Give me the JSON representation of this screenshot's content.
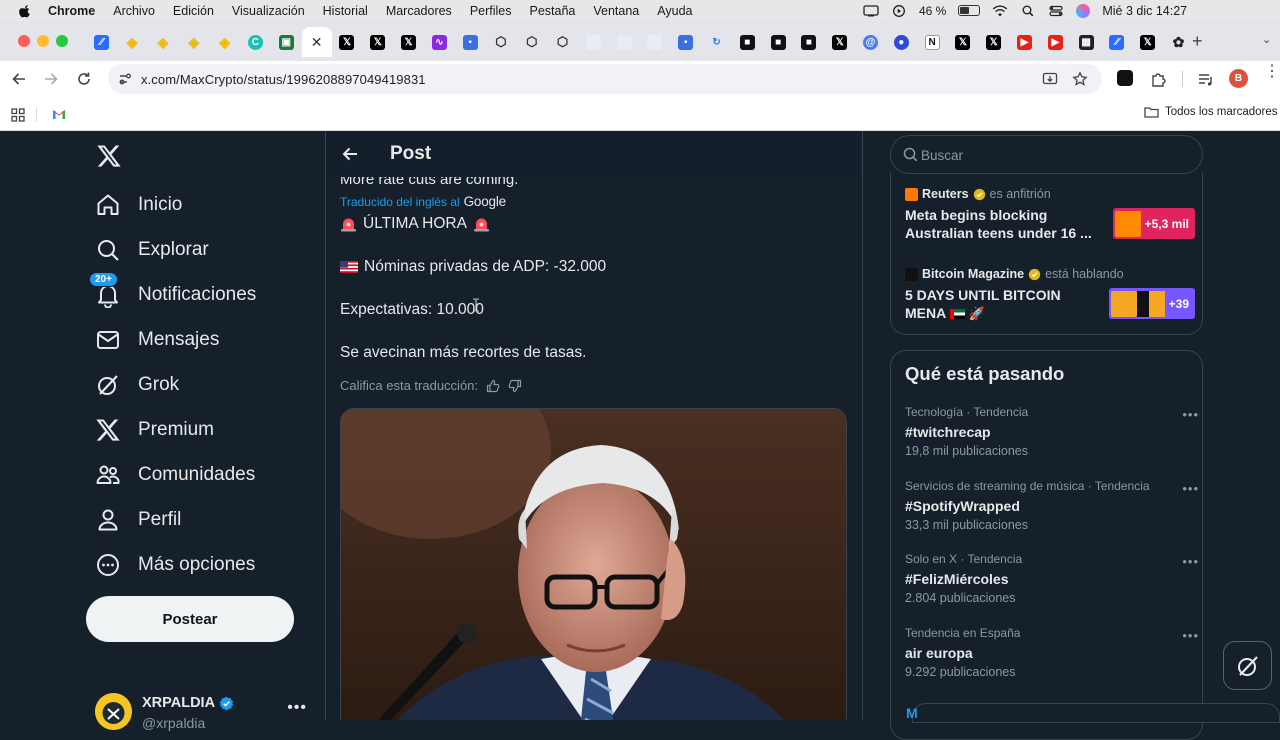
{
  "menubar": {
    "app": "Chrome",
    "items": [
      "Archivo",
      "Edición",
      "Visualización",
      "Historial",
      "Marcadores",
      "Perfiles",
      "Pestaña",
      "Ventana",
      "Ayuda"
    ],
    "battery": "46 %",
    "datetime": "Mié 3 dic 14:27"
  },
  "browser": {
    "url": "x.com/MaxCrypto/status/1996208897049419831",
    "bookmarks_all": "Todos los marcadores"
  },
  "nav": {
    "items": [
      {
        "label": "Inicio",
        "icon": "home-icon"
      },
      {
        "label": "Explorar",
        "icon": "search-icon"
      },
      {
        "label": "Notificaciones",
        "icon": "bell-icon"
      },
      {
        "label": "Mensajes",
        "icon": "mail-icon"
      },
      {
        "label": "Grok",
        "icon": "grok-icon"
      },
      {
        "label": "Premium",
        "icon": "x-icon"
      },
      {
        "label": "Comunidades",
        "icon": "communities-icon"
      },
      {
        "label": "Perfil",
        "icon": "person-icon"
      },
      {
        "label": "Más opciones",
        "icon": "more-circle-icon"
      }
    ],
    "notification_badge": "20+",
    "post_button": "Postear",
    "profile_name": "XRPALDIA",
    "profile_handle": "@xrpaldia"
  },
  "post": {
    "header_title": "Post",
    "original_text": "More rate cuts are coming.",
    "translated_label": "Traducido del inglés al",
    "translated_brand": "Google",
    "lines": {
      "breaking": "ÚLTIMA HORA",
      "adp": "Nóminas privadas de ADP: -32.000",
      "expect": "Expectativas: 10.000",
      "cuts": "Se avecinan más recortes de tasas."
    },
    "rate_prompt": "Califica esta traducción:"
  },
  "sidebar": {
    "search_placeholder": "Buscar",
    "spaces": [
      {
        "host": "Reuters",
        "role": "es anfitrión",
        "title": "Meta begins blocking Australian teens under 16 ...",
        "listeners": "+5,3 mil",
        "color": "#e0245e"
      },
      {
        "host": "Bitcoin Magazine",
        "role": "está hablando",
        "title": "5 DAYS UNTIL BITCOIN MENA",
        "listeners": "+39",
        "color": "#7856ff"
      }
    ],
    "trends_title": "Qué está pasando",
    "trends": [
      {
        "category": "Tecnología · Tendencia",
        "name": "#twitchrecap",
        "count": "19,8 mil publicaciones"
      },
      {
        "category": "Servicios de streaming de música · Tendencia",
        "name": "#SpotifyWrapped",
        "count": "33,3 mil publicaciones"
      },
      {
        "category": "Solo en X · Tendencia",
        "name": "#FelizMiércoles",
        "count": "2.804 publicaciones"
      },
      {
        "category": "Tendencia en España",
        "name": "air europa",
        "count": "9.292 publicaciones"
      }
    ],
    "messages_initial": "M"
  }
}
